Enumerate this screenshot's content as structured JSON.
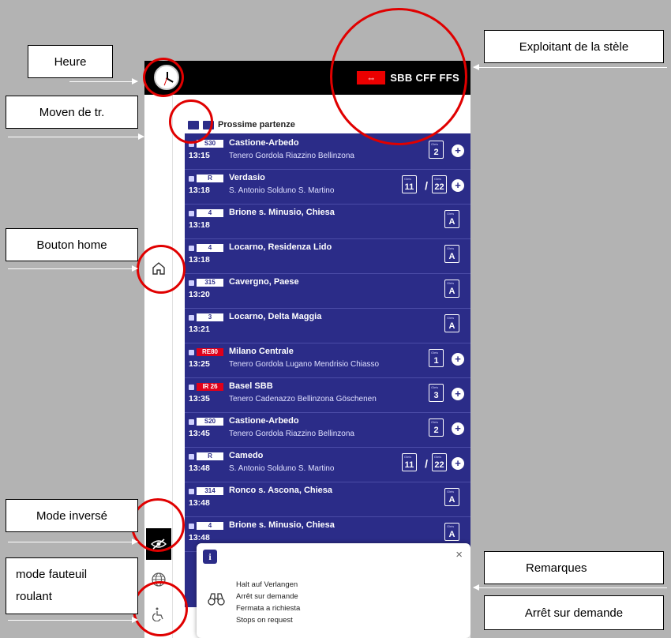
{
  "screen": {
    "operator": "SBB CFF FFS",
    "section_title": "Prossime partenze",
    "departures": [
      {
        "line": "S30",
        "line_style": "white",
        "destination": "Castione-Arbedo",
        "time": "13:15",
        "via": "Tenero  Gordola  Riazzino  Bellinzona",
        "track": "2",
        "track2": "",
        "has_plus": true
      },
      {
        "line": "R",
        "line_style": "white",
        "destination": "Verdasio",
        "time": "13:18",
        "via": "S. Antonio  Solduno  S. Martino",
        "track": "11",
        "track2": "22",
        "has_plus": true
      },
      {
        "line": "4",
        "line_style": "white",
        "destination": "Brione s. Minusio, Chiesa",
        "time": "13:18",
        "via": "",
        "track": "A",
        "track2": "",
        "has_plus": false
      },
      {
        "line": "4",
        "line_style": "white",
        "destination": "Locarno, Residenza Lido",
        "time": "13:18",
        "via": "",
        "track": "A",
        "track2": "",
        "has_plus": false
      },
      {
        "line": "315",
        "line_style": "white",
        "destination": "Cavergno, Paese",
        "time": "13:20",
        "via": "",
        "track": "A",
        "track2": "",
        "has_plus": false
      },
      {
        "line": "3",
        "line_style": "white",
        "destination": "Locarno, Delta Maggia",
        "time": "13:21",
        "via": "",
        "track": "A",
        "track2": "",
        "has_plus": false
      },
      {
        "line": "RE80",
        "line_style": "red",
        "destination": "Milano Centrale",
        "time": "13:25",
        "via": "Tenero  Gordola  Lugano  Mendrisio  Chiasso",
        "track": "1",
        "track2": "",
        "has_plus": true
      },
      {
        "line": "IR 26",
        "line_style": "red",
        "destination": "Basel SBB",
        "time": "13:35",
        "via": "Tenero  Cadenazzo  Bellinzona  Göschenen",
        "track": "3",
        "track2": "",
        "has_plus": true
      },
      {
        "line": "S20",
        "line_style": "white",
        "destination": "Castione-Arbedo",
        "time": "13:45",
        "via": "Tenero  Gordola  Riazzino  Bellinzona",
        "track": "2",
        "track2": "",
        "has_plus": true
      },
      {
        "line": "R",
        "line_style": "white",
        "destination": "Camedo",
        "time": "13:48",
        "via": "S. Antonio  Solduno  S. Martino",
        "track": "11",
        "track2": "22",
        "has_plus": true
      },
      {
        "line": "314",
        "line_style": "white",
        "destination": "Ronco s. Ascona, Chiesa",
        "time": "13:48",
        "via": "",
        "track": "A",
        "track2": "",
        "has_plus": false
      },
      {
        "line": "4",
        "line_style": "white",
        "destination": "Brione s. Minusio, Chiesa",
        "time": "13:48",
        "via": "",
        "track": "A",
        "track2": "",
        "has_plus": false
      }
    ],
    "remark": {
      "close": "×",
      "lines": [
        "Halt auf Verlangen",
        "Arrêt sur demande",
        "Fermata a richiesta",
        "Stops on request"
      ]
    }
  },
  "annotations": {
    "heure": "Heure",
    "moyen": "Moven de tr.",
    "bouton_home": "Bouton home",
    "mode_inverse": "Mode inversé",
    "fauteuil_1": "mode fauteuil",
    "fauteuil_2": "roulant",
    "exploitant": "Exploitant de la stèle",
    "remarques": "Remarques",
    "arret": "Arrêt sur demande"
  },
  "colors": {
    "board": "#2b2c88",
    "accent_red": "#eb0000",
    "annotation_ring": "#e00000"
  }
}
